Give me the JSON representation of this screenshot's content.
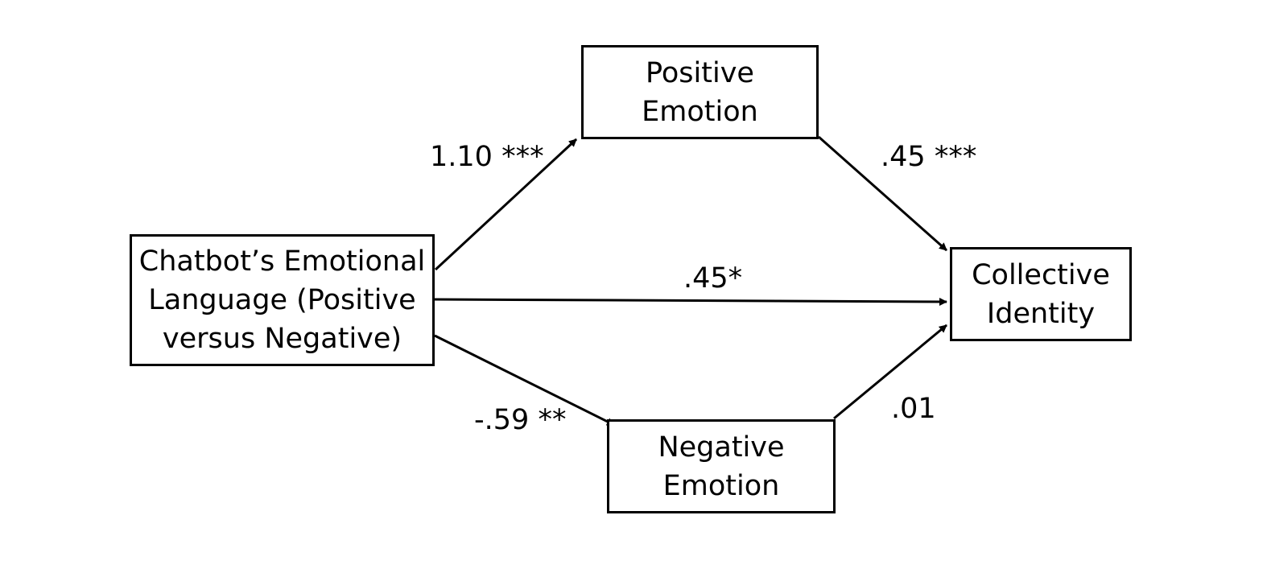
{
  "nodes": {
    "predictor": {
      "lines": [
        "Chatbot’s Emotional",
        "Language (Positive",
        "versus Negative)"
      ]
    },
    "mediator_positive": {
      "lines": [
        "Positive",
        "Emotion"
      ]
    },
    "mediator_negative": {
      "lines": [
        "Negative",
        "Emotion"
      ]
    },
    "outcome": {
      "lines": [
        "Collective",
        "Identity"
      ]
    }
  },
  "paths": {
    "predictor_to_positive": [
      "1.10",
      "***"
    ],
    "positive_to_outcome": [
      ".45",
      "***"
    ],
    "predictor_to_outcome": ".45*",
    "predictor_to_negative": [
      "-.59",
      "**"
    ],
    "negative_to_outcome": ".01"
  },
  "colors": {
    "stroke": "#000000",
    "background": "#ffffff"
  }
}
